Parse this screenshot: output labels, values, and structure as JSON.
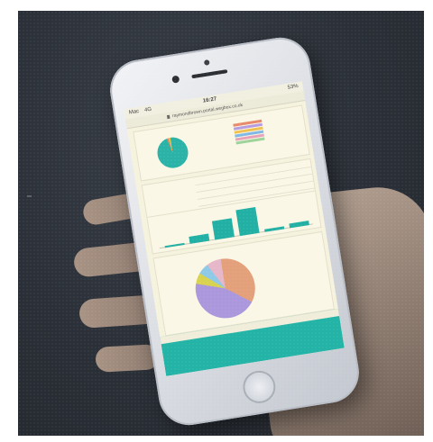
{
  "status_bar": {
    "carrier": "Mac ⠀4G",
    "time": "16:27",
    "battery": "53%"
  },
  "browser": {
    "url": "raymondbrown.portal.wegbox.co.uk"
  },
  "colors": {
    "teal": "#23b3a7",
    "pie_peach": "#e3a07a",
    "pie_lavender": "#aa97dc",
    "pie_yellow": "#d9d250",
    "screen_bg": "#f5f2dd"
  },
  "legend_chips": [
    "#e88a6a",
    "#b79be0",
    "#efc14e",
    "#7fb8e6",
    "#e7a0b8",
    "#9ed39a"
  ],
  "bars": [
    {
      "value": 0.05
    },
    {
      "value": 0.25
    },
    {
      "value": 0.7
    },
    {
      "value": 0.95
    },
    {
      "value": 0.1
    },
    {
      "value": 0.18
    }
  ]
}
